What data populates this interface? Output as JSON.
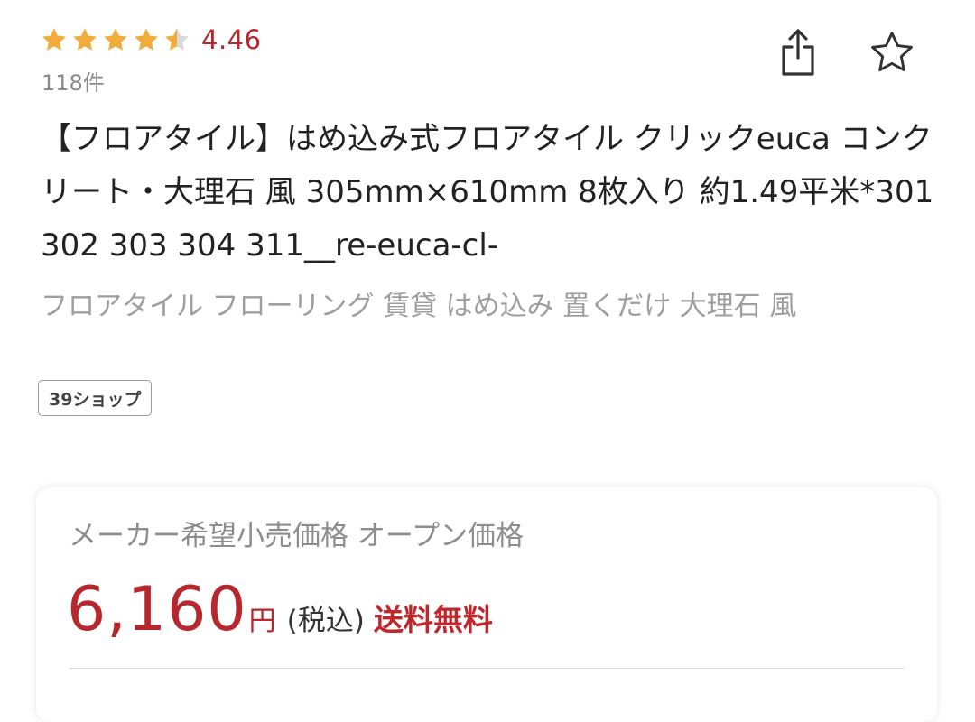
{
  "rating": {
    "value": "4.46",
    "stars": 4.46,
    "review_count": "118件",
    "star_color": "#f0ad3c",
    "star_empty_color": "#d9d9d9"
  },
  "actions": {
    "share_icon": "share-icon",
    "favorite_icon": "star-outline-icon"
  },
  "product": {
    "title": "【フロアタイル】はめ込み式フロアタイル クリックeuca コンクリート・大理石 風 305mm×610mm 8枚入り 約1.49平米*301 302 303 304 311__re-euca-cl-",
    "catchphrase": "フロアタイル フローリング 賃貸 はめ込み 置くだけ 大理石 風",
    "shop_badge": "39ショップ"
  },
  "price": {
    "msrp_label": "メーカー希望小売価格 オープン価格",
    "amount": "6,160",
    "unit": "円",
    "tax_label": "(税込)",
    "shipping_label": "送料無料",
    "accent_color": "#b7282e"
  }
}
